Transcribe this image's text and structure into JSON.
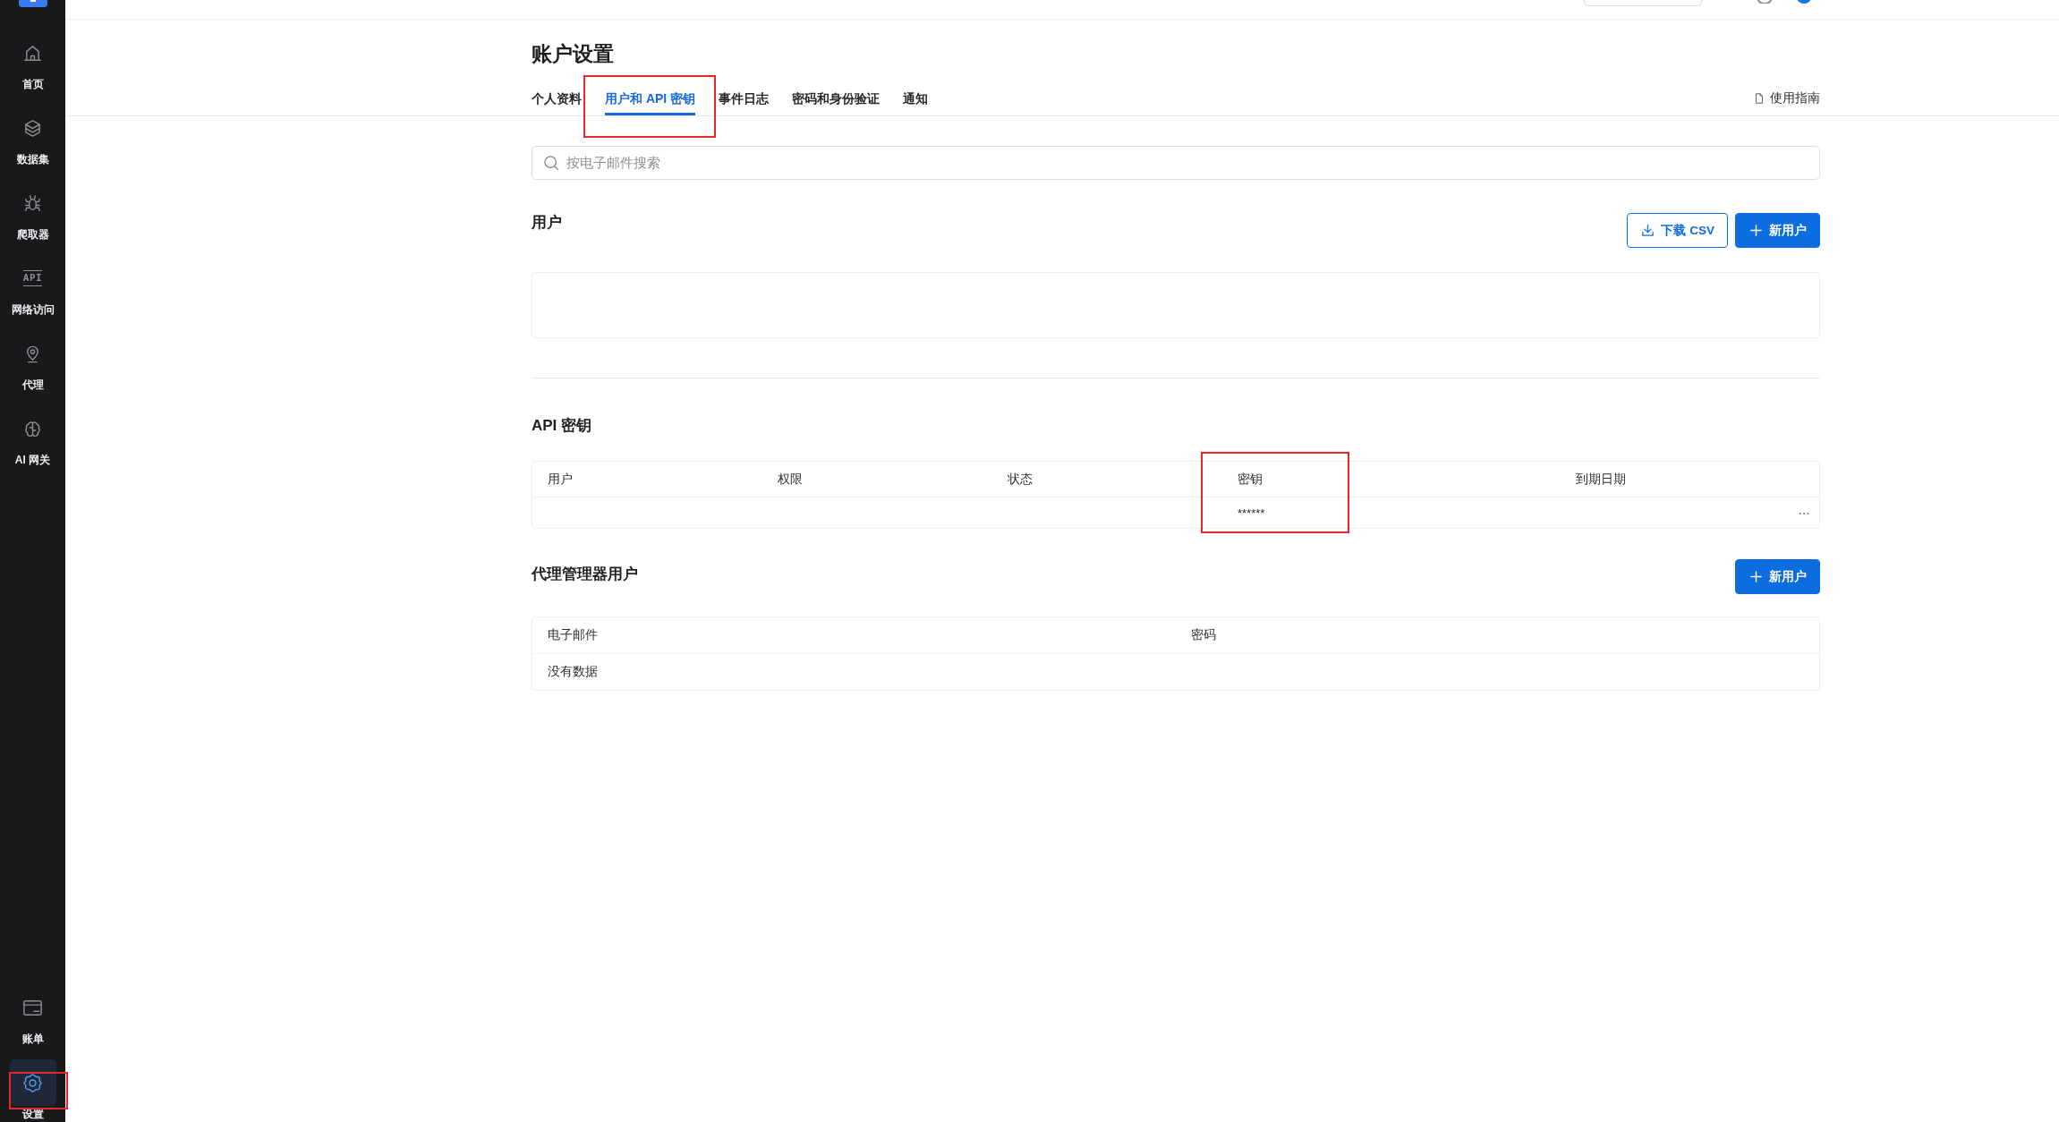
{
  "sidebar": {
    "top_items": [
      {
        "label": "首页",
        "selected": false
      },
      {
        "label": "数据集",
        "selected": false
      },
      {
        "label": "爬取器",
        "selected": false
      },
      {
        "label": "网络访问",
        "selected": false,
        "icon_text": "API"
      },
      {
        "label": "代理",
        "selected": false
      },
      {
        "label": "AI 网关",
        "selected": false
      }
    ],
    "bottom_items": [
      {
        "label": "账单",
        "selected": false,
        "highlighted": false
      },
      {
        "label": "设置",
        "selected": true,
        "highlighted": true
      }
    ]
  },
  "page": {
    "title": "账户设置"
  },
  "tabs": [
    {
      "label": "个人资料",
      "selected": false,
      "highlighted": false
    },
    {
      "label": "用户和 API 密钥",
      "selected": true,
      "highlighted": true
    },
    {
      "label": "事件日志",
      "selected": false,
      "highlighted": false
    },
    {
      "label": "密码和身份验证",
      "selected": false,
      "highlighted": false
    },
    {
      "label": "通知",
      "selected": false,
      "highlighted": false
    }
  ],
  "guide_link": "使用指南",
  "search": {
    "placeholder": "按电子邮件搜索"
  },
  "users": {
    "title": "用户",
    "buttons": [
      {
        "label": "下载 CSV",
        "kind": "outline"
      },
      {
        "label": "新用户",
        "kind": "primary"
      }
    ]
  },
  "api_keys": {
    "title": "API 密钥",
    "columns": [
      {
        "label": "用户",
        "highlighted": false
      },
      {
        "label": "权限",
        "highlighted": false
      },
      {
        "label": "状态",
        "highlighted": false
      },
      {
        "label": "密钥",
        "highlighted": true
      },
      {
        "label": "到期日期",
        "highlighted": false
      }
    ],
    "rows": [
      {
        "key": "******",
        "actions": "···"
      }
    ]
  },
  "proxy_users": {
    "title": "代理管理器用户",
    "button": {
      "label": "新用户",
      "kind": "primary"
    },
    "columns": [
      "电子邮件",
      "密码"
    ],
    "empty_text": "没有数据"
  }
}
